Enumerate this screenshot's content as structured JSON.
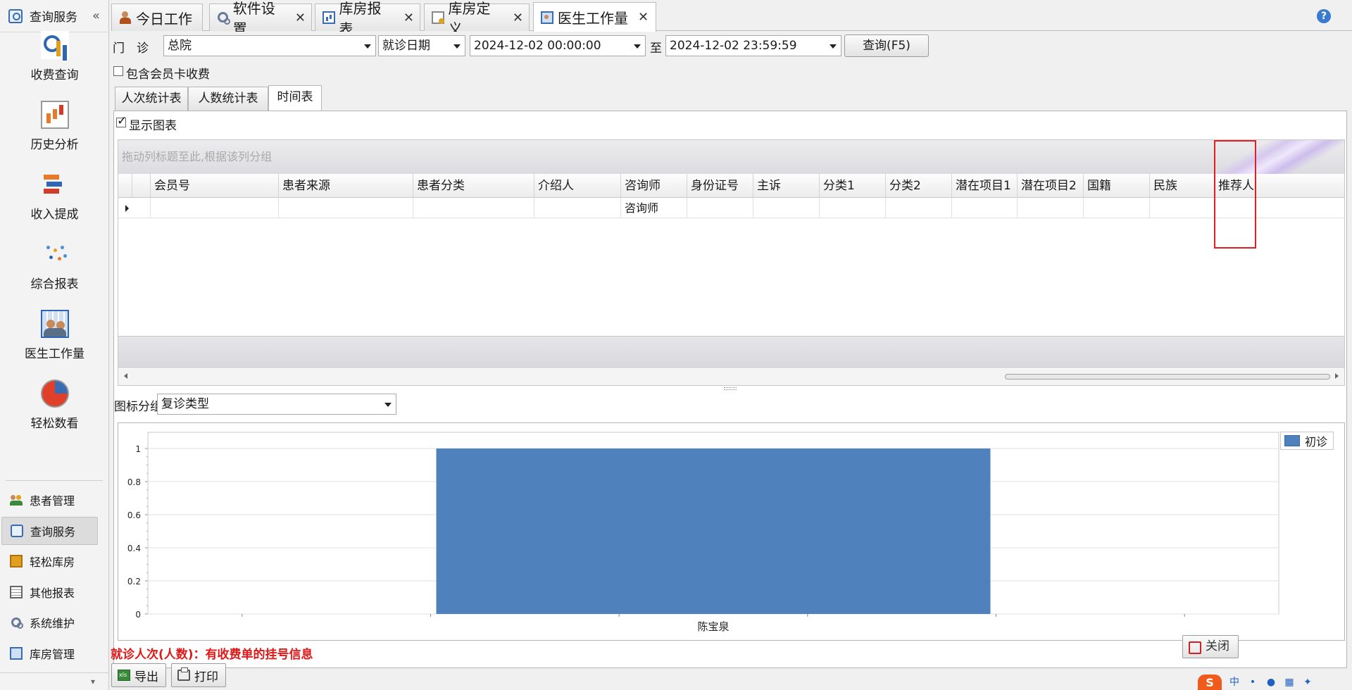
{
  "sidebar": {
    "title": "查询服务",
    "collapse_glyph": "«",
    "big_items": [
      {
        "label": "收费查询",
        "icon": "chart-search-icon"
      },
      {
        "label": "历史分析",
        "icon": "history-chart-icon"
      },
      {
        "label": "收入提成",
        "icon": "bar-stack-icon"
      },
      {
        "label": "综合报表",
        "icon": "dots-report-icon"
      },
      {
        "label": "医生工作量",
        "icon": "doctor-board-icon"
      },
      {
        "label": "轻松数看",
        "icon": "pie-chart-icon"
      }
    ],
    "nav_items": [
      {
        "label": "患者管理",
        "icon": "patients-icon"
      },
      {
        "label": "查询服务",
        "icon": "search-icon",
        "active": true
      },
      {
        "label": "轻松库房",
        "icon": "box-icon"
      },
      {
        "label": "其他报表",
        "icon": "report-icon"
      },
      {
        "label": "系统维护",
        "icon": "gears-icon"
      },
      {
        "label": "库房管理",
        "icon": "storage-icon"
      }
    ],
    "bottom_glyph": "▾"
  },
  "tabs": [
    {
      "label": "今日工作",
      "icon": "worker-icon",
      "closable": false
    },
    {
      "label": "软件设置",
      "icon": "gear-icon",
      "closable": true
    },
    {
      "label": "库房报表",
      "icon": "chart-icon",
      "closable": true
    },
    {
      "label": "库房定义",
      "icon": "definition-icon",
      "closable": true
    },
    {
      "label": "医生工作量",
      "icon": "doctor-icon",
      "closable": true,
      "active": true
    }
  ],
  "help_glyph": "?",
  "close_glyph": "✕",
  "filters": {
    "dept_label": "门　诊",
    "dept_value": "总院",
    "date_type": "就诊日期",
    "start": "2024-12-02 00:00:00",
    "to_label": "至",
    "end": "2024-12-02 23:59:59",
    "query_button": "查询(F5)",
    "member_card_label": "包含会员卡收费",
    "member_card_checked": false
  },
  "subtabs": [
    {
      "label": "人次统计表"
    },
    {
      "label": "人数统计表"
    },
    {
      "label": "时间表",
      "active": true
    }
  ],
  "show_chart_label": "显示图表",
  "show_chart_checked": true,
  "grid": {
    "group_panel_text": "拖动列标题至此,根据该列分组",
    "columns": [
      "会员号",
      "患者来源",
      "患者分类",
      "介绍人",
      "咨询师",
      "身份证号",
      "主诉",
      "分类1",
      "分类2",
      "潜在项目1",
      "潜在项目2",
      "国籍",
      "民族",
      "推荐人"
    ],
    "rows": [
      [
        "",
        "",
        "",
        "",
        "咨询师",
        "",
        "",
        "",
        "",
        "",
        "",
        "",
        "",
        ""
      ]
    ]
  },
  "chart_group": {
    "label": "图标分组",
    "value": "复诊类型"
  },
  "chart_data": {
    "type": "bar",
    "categories": [
      "陈宝泉"
    ],
    "series": [
      {
        "name": "初诊",
        "values": [
          1
        ]
      }
    ],
    "ylim": [
      0,
      1
    ],
    "yticks": [
      "0",
      "0.2",
      "0.4",
      "0.6",
      "0.8",
      "1"
    ],
    "grid": true,
    "legend": "top-right",
    "colors": {
      "bar": "#4f81bd"
    }
  },
  "footnote": "就诊人次(人数)：有收费单的挂号信息",
  "toolbar": {
    "export_label": "导出",
    "print_label": "打印",
    "close_label": "关闭"
  },
  "tray": {
    "sogou": "S",
    "ime": "中"
  }
}
